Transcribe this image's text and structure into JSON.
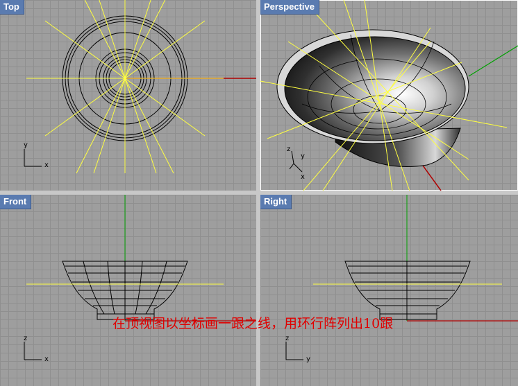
{
  "viewports": {
    "top": {
      "title": "Top",
      "axis_x": "x",
      "axis_y": "y"
    },
    "perspective": {
      "title": "Perspective",
      "axis_x": "x",
      "axis_y": "y",
      "axis_z": "z"
    },
    "front": {
      "title": "Front",
      "axis_x": "x",
      "axis_y": "z"
    },
    "right": {
      "title": "Right",
      "axis_x": "y",
      "axis_y": "z"
    }
  },
  "annotation": "在顶视图以坐标画一跟之线，用环行阵列出10跟",
  "colors": {
    "viewport_bg": "#9e9e9e",
    "grid": "#8f8f8f",
    "title_bg": "#5a7bb0",
    "construction_line": "#ffff40",
    "x_axis": "#b00000",
    "y_axis": "#00a000",
    "annotation": "#e00000"
  }
}
